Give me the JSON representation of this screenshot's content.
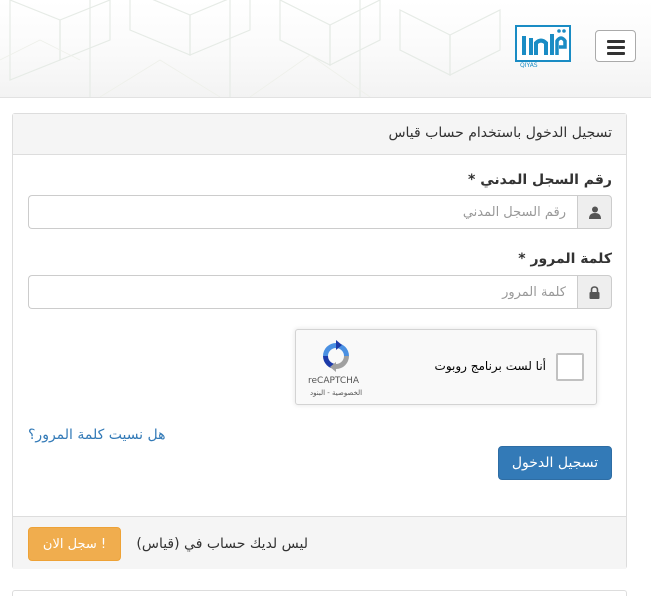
{
  "header": {
    "menu_icon": "hamburger-menu-icon",
    "logo_icon": "qiyas-logo-icon",
    "logo_text": "QIYAS"
  },
  "panel": {
    "title": "تسجيل الدخول باستخدام حساب قياس"
  },
  "form": {
    "id_label": "رقم السجل المدني *",
    "id_placeholder": "رقم السجل المدني",
    "id_icon": "user-icon",
    "password_label": "كلمة المرور *",
    "password_placeholder": "كلمة المرور",
    "password_icon": "lock-icon"
  },
  "recaptcha": {
    "label": "أنا لست برنامج روبوت",
    "brand": "reCAPTCHA",
    "links": "الخصوصية - البنود",
    "icon": "recaptcha-logo-icon"
  },
  "actions": {
    "forgot_password": "هل نسيت كلمة المرور؟",
    "login_button": "تسجيل الدخول"
  },
  "footer": {
    "text": "ليس لديك حساب في (قياس)",
    "register_button": "سجل الان !"
  },
  "colors": {
    "primary": "#337ab7",
    "warning": "#f0ad4e",
    "link": "#337ab7",
    "logo": "#1a8cc4"
  }
}
